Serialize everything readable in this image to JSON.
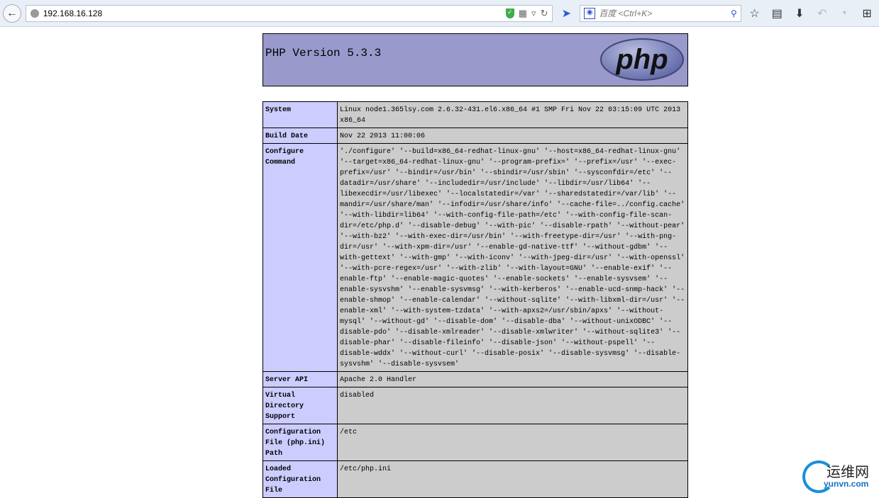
{
  "browser": {
    "url": "192.168.16.128",
    "search_placeholder": "百度 <Ctrl+K>"
  },
  "header": {
    "title": "PHP Version 5.3.3",
    "logo_text": "php"
  },
  "rows": [
    {
      "label": "System",
      "value": "Linux node1.365lsy.com 2.6.32-431.el6.x86_64 #1 SMP Fri Nov 22 03:15:09 UTC 2013 x86_64"
    },
    {
      "label": "Build Date",
      "value": "Nov 22 2013 11:00:06"
    },
    {
      "label": "Configure Command",
      "value": "'./configure' '--build=x86_64-redhat-linux-gnu' '--host=x86_64-redhat-linux-gnu' '--target=x86_64-redhat-linux-gnu' '--program-prefix=' '--prefix=/usr' '--exec-prefix=/usr' '--bindir=/usr/bin' '--sbindir=/usr/sbin' '--sysconfdir=/etc' '--datadir=/usr/share' '--includedir=/usr/include' '--libdir=/usr/lib64' '--libexecdir=/usr/libexec' '--localstatedir=/var' '--sharedstatedir=/var/lib' '--mandir=/usr/share/man' '--infodir=/usr/share/info' '--cache-file=../config.cache' '--with-libdir=lib64' '--with-config-file-path=/etc' '--with-config-file-scan-dir=/etc/php.d' '--disable-debug' '--with-pic' '--disable-rpath' '--without-pear' '--with-bz2' '--with-exec-dir=/usr/bin' '--with-freetype-dir=/usr' '--with-png-dir=/usr' '--with-xpm-dir=/usr' '--enable-gd-native-ttf' '--without-gdbm' '--with-gettext' '--with-gmp' '--with-iconv' '--with-jpeg-dir=/usr' '--with-openssl' '--with-pcre-regex=/usr' '--with-zlib' '--with-layout=GNU' '--enable-exif' '--enable-ftp' '--enable-magic-quotes' '--enable-sockets' '--enable-sysvsem' '--enable-sysvshm' '--enable-sysvmsg' '--with-kerberos' '--enable-ucd-snmp-hack' '--enable-shmop' '--enable-calendar' '--without-sqlite' '--with-libxml-dir=/usr' '--enable-xml' '--with-system-tzdata' '--with-apxs2=/usr/sbin/apxs' '--without-mysql' '--without-gd' '--disable-dom' '--disable-dba' '--without-unixODBC' '--disable-pdo' '--disable-xmlreader' '--disable-xmlwriter' '--without-sqlite3' '--disable-phar' '--disable-fileinfo' '--disable-json' '--without-pspell' '--disable-wddx' '--without-curl' '--disable-posix' '--disable-sysvmsg' '--disable-sysvshm' '--disable-sysvsem'"
    },
    {
      "label": "Server API",
      "value": "Apache 2.0 Handler"
    },
    {
      "label": "Virtual Directory Support",
      "value": "disabled"
    },
    {
      "label": "Configuration File (php.ini) Path",
      "value": "/etc"
    },
    {
      "label": "Loaded Configuration File",
      "value": "/etc/php.ini"
    }
  ],
  "watermark": {
    "cn": "运维网",
    "en": "yunvn.com"
  }
}
